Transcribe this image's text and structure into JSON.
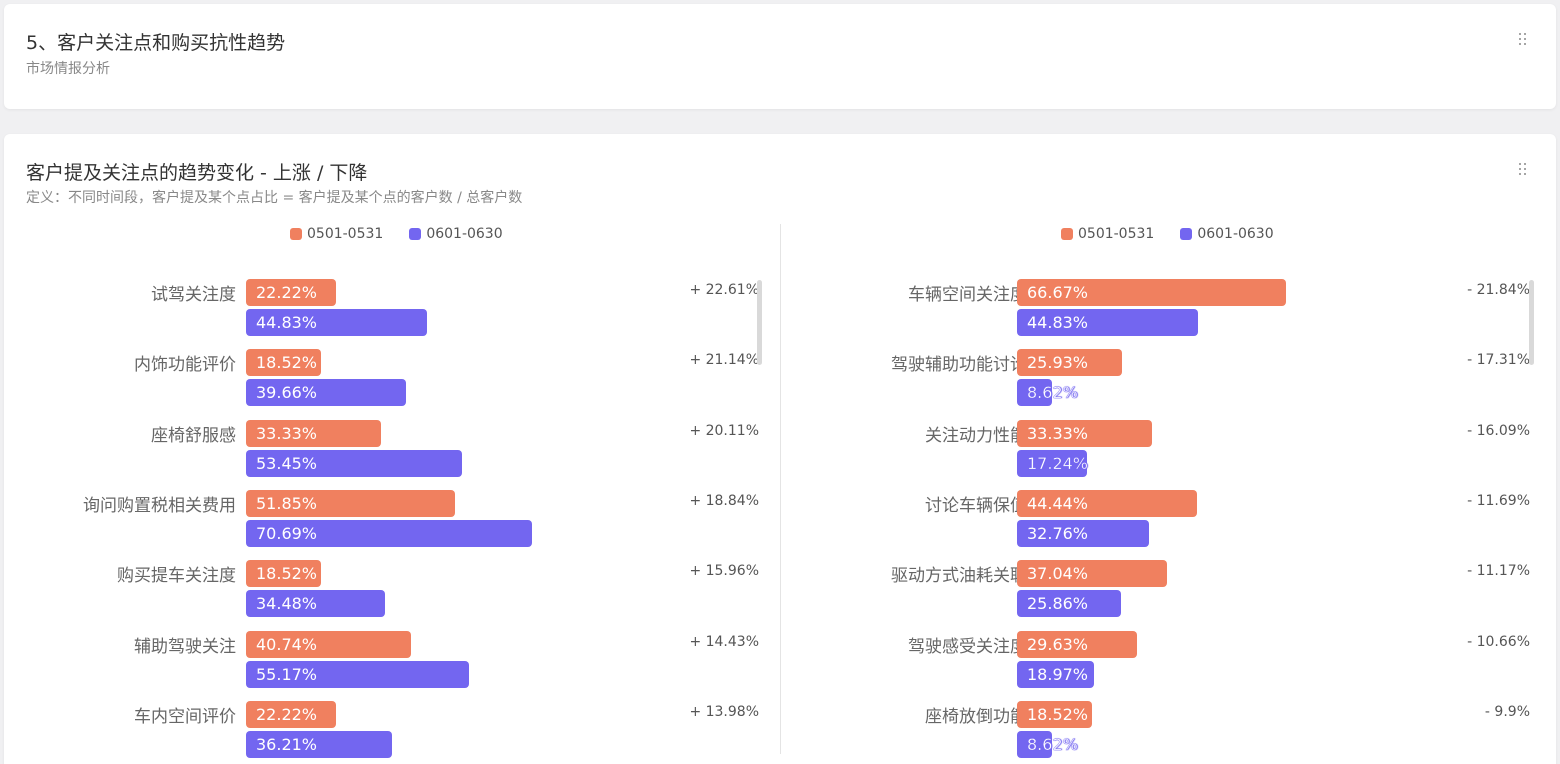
{
  "header": {
    "title": "5、客户关注点和购买抗性趋势",
    "subtitle": "市场情报分析"
  },
  "chart_card": {
    "title": "客户提及关注点的趋势变化 - 上涨 / 下降",
    "definition": "定义：不同时间段，客户提及某个点占比 = 客户提及某个点的客户数 / 总客户数"
  },
  "colors": {
    "period_a": "#f0805f",
    "period_b": "#7366f0"
  },
  "icons": {
    "drag": "drag-handle-icon"
  },
  "chart_data": [
    {
      "type": "bar",
      "orientation": "horizontal",
      "title": "上涨",
      "legend": [
        "0501-0531",
        "0601-0630"
      ],
      "legend_position": "top",
      "categories": [
        "试驾关注度",
        "内饰功能评价",
        "座椅舒服感",
        "询问购置税相关费用",
        "购买提车关注度",
        "辅助驾驶关注",
        "车内空间评价"
      ],
      "series": [
        {
          "name": "0501-0531",
          "color": "#f0805f",
          "values": [
            22.22,
            18.52,
            33.33,
            51.85,
            18.52,
            40.74,
            22.22
          ],
          "labels": [
            "22.22%",
            "18.52%",
            "33.33%",
            "51.85%",
            "18.52%",
            "40.74%",
            "22.22%"
          ]
        },
        {
          "name": "0601-0630",
          "color": "#7366f0",
          "values": [
            44.83,
            39.66,
            53.45,
            70.69,
            34.48,
            55.17,
            36.21
          ],
          "labels": [
            "44.83%",
            "39.66%",
            "53.45%",
            "70.69%",
            "34.48%",
            "55.17%",
            "36.21%"
          ]
        }
      ],
      "changes": [
        "+ 22.61%",
        "+ 21.14%",
        "+ 20.11%",
        "+ 18.84%",
        "+ 15.96%",
        "+ 14.43%",
        "+ 13.98%"
      ],
      "xlim": [
        0,
        100
      ]
    },
    {
      "type": "bar",
      "orientation": "horizontal",
      "title": "下降",
      "legend": [
        "0501-0531",
        "0601-0630"
      ],
      "legend_position": "top",
      "categories": [
        "车辆空间关注度",
        "驾驶辅助功能讨论",
        "关注动力性能",
        "讨论车辆保值",
        "驱动方式油耗关联",
        "驾驶感受关注度",
        "座椅放倒功能"
      ],
      "series": [
        {
          "name": "0501-0531",
          "color": "#f0805f",
          "values": [
            66.67,
            25.93,
            33.33,
            44.44,
            37.04,
            29.63,
            18.52
          ],
          "labels": [
            "66.67%",
            "25.93%",
            "33.33%",
            "44.44%",
            "37.04%",
            "29.63%",
            "18.52%"
          ]
        },
        {
          "name": "0601-0630",
          "color": "#7366f0",
          "values": [
            44.83,
            8.62,
            17.24,
            32.76,
            25.86,
            18.97,
            8.62
          ],
          "labels": [
            "44.83%",
            "8.62%",
            "17.24%",
            "32.76%",
            "25.86%",
            "18.97%",
            "8.62%"
          ]
        }
      ],
      "changes": [
        "- 21.84%",
        "- 17.31%",
        "- 16.09%",
        "- 11.69%",
        "- 11.17%",
        "- 10.66%",
        "- 9.9%"
      ],
      "xlim": [
        0,
        100
      ]
    }
  ]
}
